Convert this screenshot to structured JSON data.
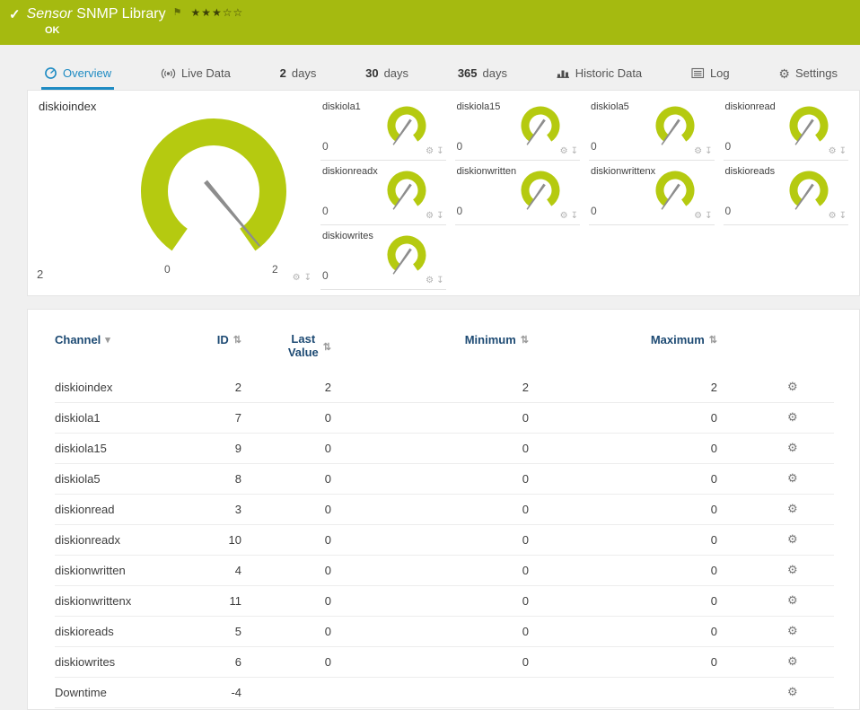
{
  "colors": {
    "header_green": "#a5ba10",
    "gauge_green": "#b5ca10",
    "accent_blue": "#1e8bc3",
    "table_header_blue": "#1d4a73"
  },
  "header": {
    "title_word": "Sensor",
    "title_name": "SNMP Library",
    "status": "OK",
    "stars": "★★★☆☆"
  },
  "icons": {
    "check": "✓",
    "flag": "⚑",
    "gear": "⚙",
    "pin": "↧",
    "sort": "⇅",
    "sort_desc": "▾"
  },
  "tabs": {
    "overview": {
      "label": "Overview"
    },
    "live": {
      "label": "Live Data"
    },
    "d2": {
      "prefix": "2",
      "label": "days"
    },
    "d30": {
      "prefix": "30",
      "label": "days"
    },
    "d365": {
      "prefix": "365",
      "label": "days"
    },
    "historic": {
      "label": "Historic Data"
    },
    "log": {
      "label": "Log"
    },
    "settings": {
      "label": "Settings"
    }
  },
  "gauges": {
    "main": {
      "label": "diskioindex",
      "value": "2",
      "scale_start": "0",
      "scale_end": "2"
    },
    "tiles": [
      {
        "label": "diskiola1",
        "value": "0"
      },
      {
        "label": "diskiola15",
        "value": "0"
      },
      {
        "label": "diskiola5",
        "value": "0"
      },
      {
        "label": "diskionread",
        "value": "0"
      },
      {
        "label": "diskionreadx",
        "value": "0"
      },
      {
        "label": "diskionwritten",
        "value": "0"
      },
      {
        "label": "diskionwrittenx",
        "value": "0"
      },
      {
        "label": "diskioreads",
        "value": "0"
      },
      {
        "label": "diskiowrites",
        "value": "0"
      }
    ]
  },
  "table": {
    "headers": {
      "channel": "Channel",
      "id": "ID",
      "last1": "Last",
      "last2": "Value",
      "minimum": "Minimum",
      "maximum": "Maximum"
    },
    "rows": [
      {
        "channel": "diskioindex",
        "id": "2",
        "last": "2",
        "min": "2",
        "max": "2"
      },
      {
        "channel": "diskiola1",
        "id": "7",
        "last": "0",
        "min": "0",
        "max": "0"
      },
      {
        "channel": "diskiola15",
        "id": "9",
        "last": "0",
        "min": "0",
        "max": "0"
      },
      {
        "channel": "diskiola5",
        "id": "8",
        "last": "0",
        "min": "0",
        "max": "0"
      },
      {
        "channel": "diskionread",
        "id": "3",
        "last": "0",
        "min": "0",
        "max": "0"
      },
      {
        "channel": "diskionreadx",
        "id": "10",
        "last": "0",
        "min": "0",
        "max": "0"
      },
      {
        "channel": "diskionwritten",
        "id": "4",
        "last": "0",
        "min": "0",
        "max": "0"
      },
      {
        "channel": "diskionwrittenx",
        "id": "11",
        "last": "0",
        "min": "0",
        "max": "0"
      },
      {
        "channel": "diskioreads",
        "id": "5",
        "last": "0",
        "min": "0",
        "max": "0"
      },
      {
        "channel": "diskiowrites",
        "id": "6",
        "last": "0",
        "min": "0",
        "max": "0"
      },
      {
        "channel": "Downtime",
        "id": "-4",
        "last": "",
        "min": "",
        "max": ""
      }
    ]
  }
}
